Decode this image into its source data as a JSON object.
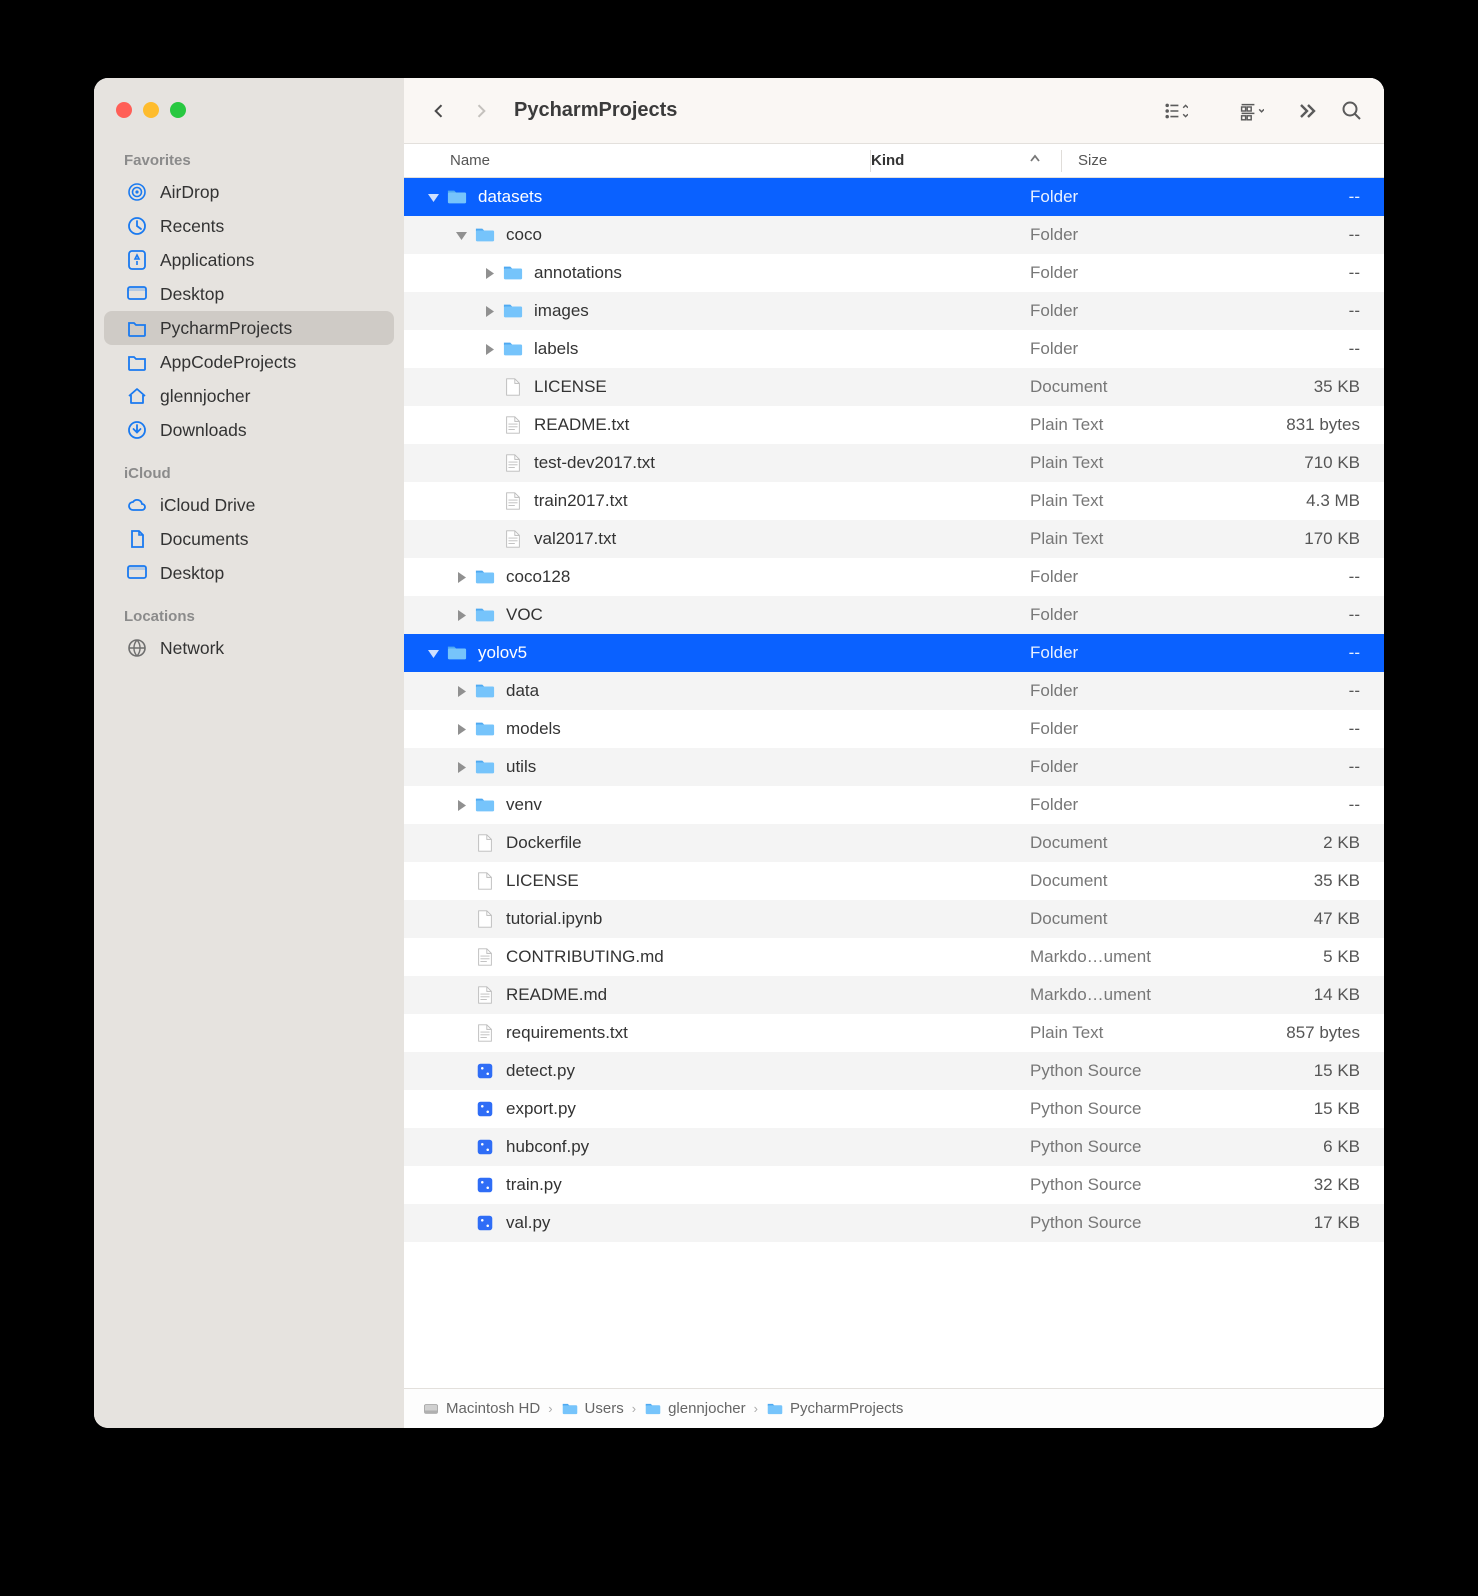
{
  "window": {
    "title": "PycharmProjects"
  },
  "sidebar": {
    "sections": [
      {
        "title": "Favorites",
        "items": [
          {
            "icon": "airdrop",
            "label": "AirDrop"
          },
          {
            "icon": "recents",
            "label": "Recents"
          },
          {
            "icon": "apps",
            "label": "Applications"
          },
          {
            "icon": "desktop",
            "label": "Desktop"
          },
          {
            "icon": "folder",
            "label": "PycharmProjects",
            "selected": true
          },
          {
            "icon": "folder",
            "label": "AppCodeProjects"
          },
          {
            "icon": "home",
            "label": "glennjocher"
          },
          {
            "icon": "downloads",
            "label": "Downloads"
          }
        ]
      },
      {
        "title": "iCloud",
        "items": [
          {
            "icon": "cloud",
            "label": "iCloud Drive"
          },
          {
            "icon": "doc",
            "label": "Documents"
          },
          {
            "icon": "desktop",
            "label": "Desktop"
          }
        ]
      },
      {
        "title": "Locations",
        "items": [
          {
            "icon": "network",
            "label": "Network",
            "grey": true
          }
        ]
      }
    ]
  },
  "columns": {
    "name": "Name",
    "kind": "Kind",
    "size": "Size",
    "sort": "kind-asc"
  },
  "rows": [
    {
      "depth": 0,
      "disc": "down",
      "icon": "folder",
      "name": "datasets",
      "kind": "Folder",
      "size": "--",
      "selected": true
    },
    {
      "depth": 1,
      "disc": "down",
      "icon": "folder",
      "name": "coco",
      "kind": "Folder",
      "size": "--"
    },
    {
      "depth": 2,
      "disc": "right",
      "icon": "folder",
      "name": "annotations",
      "kind": "Folder",
      "size": "--"
    },
    {
      "depth": 2,
      "disc": "right",
      "icon": "folder",
      "name": "images",
      "kind": "Folder",
      "size": "--"
    },
    {
      "depth": 2,
      "disc": "right",
      "icon": "folder",
      "name": "labels",
      "kind": "Folder",
      "size": "--"
    },
    {
      "depth": 2,
      "disc": "none",
      "icon": "doc",
      "name": "LICENSE",
      "kind": "Document",
      "size": "35 KB"
    },
    {
      "depth": 2,
      "disc": "none",
      "icon": "txt",
      "name": "README.txt",
      "kind": "Plain Text",
      "size": "831 bytes"
    },
    {
      "depth": 2,
      "disc": "none",
      "icon": "txt",
      "name": "test-dev2017.txt",
      "kind": "Plain Text",
      "size": "710 KB"
    },
    {
      "depth": 2,
      "disc": "none",
      "icon": "txt",
      "name": "train2017.txt",
      "kind": "Plain Text",
      "size": "4.3 MB"
    },
    {
      "depth": 2,
      "disc": "none",
      "icon": "txt",
      "name": "val2017.txt",
      "kind": "Plain Text",
      "size": "170 KB"
    },
    {
      "depth": 1,
      "disc": "right",
      "icon": "folder",
      "name": "coco128",
      "kind": "Folder",
      "size": "--"
    },
    {
      "depth": 1,
      "disc": "right",
      "icon": "folder",
      "name": "VOC",
      "kind": "Folder",
      "size": "--"
    },
    {
      "depth": 0,
      "disc": "down",
      "icon": "folder",
      "name": "yolov5",
      "kind": "Folder",
      "size": "--",
      "selected": true
    },
    {
      "depth": 1,
      "disc": "right",
      "icon": "folder",
      "name": "data",
      "kind": "Folder",
      "size": "--"
    },
    {
      "depth": 1,
      "disc": "right",
      "icon": "folder",
      "name": "models",
      "kind": "Folder",
      "size": "--"
    },
    {
      "depth": 1,
      "disc": "right",
      "icon": "folder",
      "name": "utils",
      "kind": "Folder",
      "size": "--"
    },
    {
      "depth": 1,
      "disc": "right",
      "icon": "folder",
      "name": "venv",
      "kind": "Folder",
      "size": "--"
    },
    {
      "depth": 1,
      "disc": "none",
      "icon": "doc",
      "name": "Dockerfile",
      "kind": "Document",
      "size": "2 KB"
    },
    {
      "depth": 1,
      "disc": "none",
      "icon": "doc",
      "name": "LICENSE",
      "kind": "Document",
      "size": "35 KB"
    },
    {
      "depth": 1,
      "disc": "none",
      "icon": "doc",
      "name": "tutorial.ipynb",
      "kind": "Document",
      "size": "47 KB"
    },
    {
      "depth": 1,
      "disc": "none",
      "icon": "txt",
      "name": "CONTRIBUTING.md",
      "kind": "Markdo…ument",
      "size": "5 KB"
    },
    {
      "depth": 1,
      "disc": "none",
      "icon": "txt",
      "name": "README.md",
      "kind": "Markdo…ument",
      "size": "14 KB"
    },
    {
      "depth": 1,
      "disc": "none",
      "icon": "txt",
      "name": "requirements.txt",
      "kind": "Plain Text",
      "size": "857 bytes"
    },
    {
      "depth": 1,
      "disc": "none",
      "icon": "py",
      "name": "detect.py",
      "kind": "Python Source",
      "size": "15 KB"
    },
    {
      "depth": 1,
      "disc": "none",
      "icon": "py",
      "name": "export.py",
      "kind": "Python Source",
      "size": "15 KB"
    },
    {
      "depth": 1,
      "disc": "none",
      "icon": "py",
      "name": "hubconf.py",
      "kind": "Python Source",
      "size": "6 KB"
    },
    {
      "depth": 1,
      "disc": "none",
      "icon": "py",
      "name": "train.py",
      "kind": "Python Source",
      "size": "32 KB"
    },
    {
      "depth": 1,
      "disc": "none",
      "icon": "py",
      "name": "val.py",
      "kind": "Python Source",
      "size": "17 KB"
    }
  ],
  "path": [
    {
      "icon": "disk",
      "label": "Macintosh HD"
    },
    {
      "icon": "folder",
      "label": "Users"
    },
    {
      "icon": "folder",
      "label": "glennjocher"
    },
    {
      "icon": "folder",
      "label": "PycharmProjects"
    }
  ]
}
